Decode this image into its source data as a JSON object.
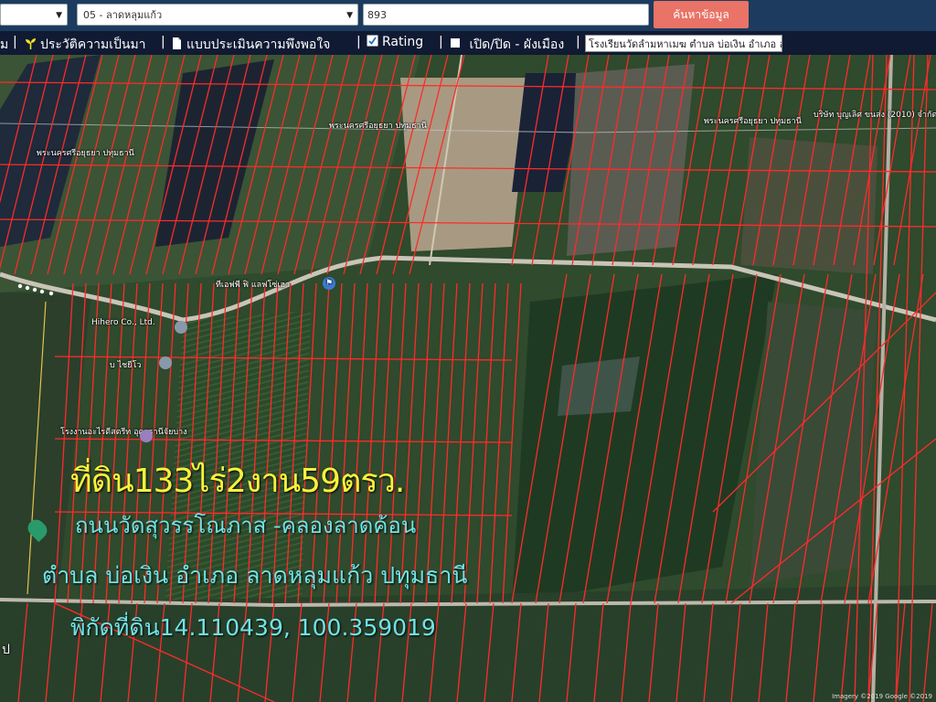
{
  "search": {
    "province_value": "",
    "district_value": "05 - ลาดหลุมแก้ว",
    "parcel_value": "893",
    "search_button": "ค้นหาข้อมูล"
  },
  "menu": {
    "first_fragment": "ม",
    "items": [
      {
        "label": "ประวัติความเป็นมา",
        "icon": "sprout-icon"
      },
      {
        "label": "แบบประเมินความพึงพอใจ",
        "icon": "document-icon"
      },
      {
        "label": "Rating",
        "icon": "checkbox-icon"
      },
      {
        "label": "เปิด/ปิด - ผังเมือง",
        "icon": "square-icon"
      }
    ],
    "place_search_value": "โรงเรียนวัดลำมหาเมฆ ตำบล บ่อเงิน อำเภอ ล"
  },
  "map": {
    "labels": [
      "พระนครศรีอยุธยา ปทุมธานี",
      "พระนครศรีอยุธยา ปทุมธานี",
      "พระนครศรีอยุธยา ปทุมธานี",
      "ทีเอฟพี ฟิ แลฟโซ่เฮา",
      "Hihero Co., Ltd.",
      "บ ไชยีโว",
      "โรงงานอะไรดีสตรีท อุดรธานีจัยบาง",
      "บริษัท บุญเลิศ ขนส่ง (2010) จำกัด",
      "ป"
    ],
    "attribution": "Imagery ©2019 Google ©2019"
  },
  "overlay": {
    "line1": "ที่ดิน133ไร่2งาน59ตรว.",
    "line2": "ถนนวัดสุวรรโณภาส -คลองลาดค้อน",
    "line3": "ตำบล บ่อเงิน อำเภอ ลาดหลุมแก้ว ปทุมธานี",
    "line4": "พิกัดที่ดิน14.110439, 100.359019"
  },
  "colors": {
    "header_bg": "#1c3b5e",
    "menu_bg": "#101a33",
    "search_button": "#e97366",
    "parcel_lines": "#ff2a2a",
    "title_yellow": "#f6f23c",
    "title_cyan": "#6fe3e6"
  }
}
